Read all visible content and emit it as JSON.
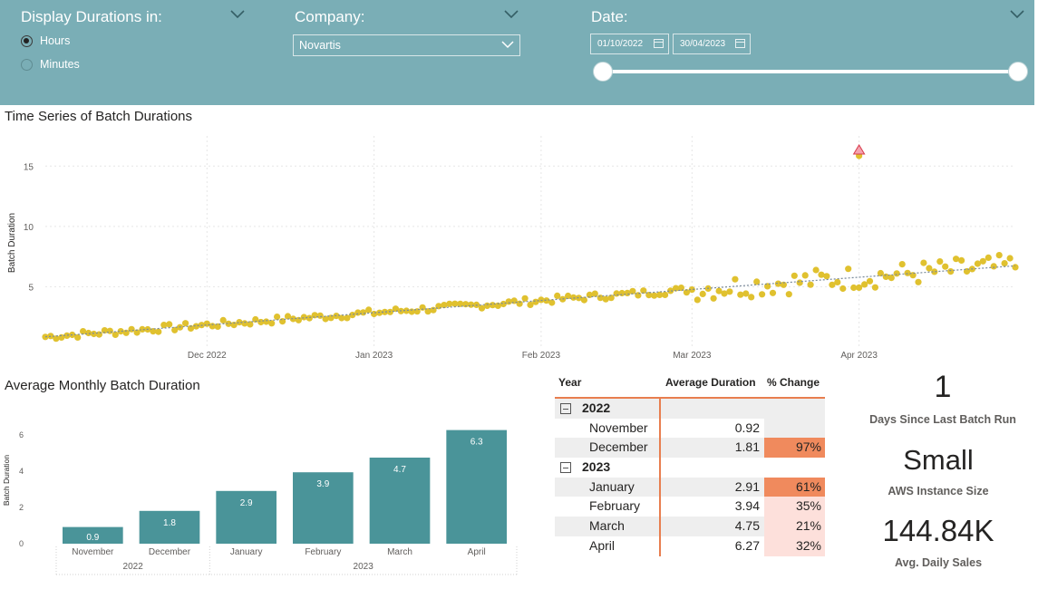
{
  "filters": {
    "duration": {
      "title": "Display Durations in:",
      "options": [
        {
          "label": "Hours",
          "selected": true
        },
        {
          "label": "Minutes",
          "selected": false
        }
      ]
    },
    "company": {
      "title": "Company:",
      "selected": "Novartis"
    },
    "date": {
      "title": "Date:",
      "start": "01/10/2022",
      "end": "30/04/2023",
      "range_fraction": [
        0,
        1
      ]
    }
  },
  "time_series": {
    "title": "Time Series of Batch Durations",
    "chart_data": {
      "type": "scatter",
      "ylabel": "Batch Duration",
      "y_ticks": [
        5,
        10,
        15
      ],
      "ylim": [
        0,
        17.5
      ],
      "x_ticks": [
        "Dec 2022",
        "Jan 2023",
        "Feb 2023",
        "Mar 2023",
        "Apr 2023"
      ],
      "x_start": "2022-11-01",
      "x_end": "2023-04-30",
      "trendline": true,
      "outlier_marker": {
        "date": "2023-04-01",
        "value": 16.3
      },
      "point_color": "#e0c12f"
    }
  },
  "monthly": {
    "title": "Average Monthly Batch Duration",
    "chart_data": {
      "type": "bar",
      "categories": [
        "November",
        "December",
        "January",
        "February",
        "March",
        "April"
      ],
      "years": [
        {
          "label": "2022",
          "span": 2
        },
        {
          "label": "2023",
          "span": 4
        }
      ],
      "values": [
        0.92,
        1.81,
        2.91,
        3.94,
        4.75,
        6.27
      ],
      "data_labels": [
        "0.9",
        "1.8",
        "2.9",
        "3.9",
        "4.7",
        "6.3"
      ],
      "ylabel": "Batch Duration",
      "y_ticks": [
        "0",
        "2",
        "4",
        "6"
      ],
      "ylim": [
        0,
        7
      ],
      "bar_color": "#4a9499"
    }
  },
  "table": {
    "headers": {
      "year": "Year",
      "avg": "Average Duration",
      "pct": "% Change"
    },
    "groups": [
      {
        "year": "2022",
        "rows": [
          {
            "month": "November",
            "avg": "0.92",
            "pct": ""
          },
          {
            "month": "December",
            "avg": "1.81",
            "pct": "97%"
          }
        ]
      },
      {
        "year": "2023",
        "rows": [
          {
            "month": "January",
            "avg": "2.91",
            "pct": "61%"
          },
          {
            "month": "February",
            "avg": "3.94",
            "pct": "35%"
          },
          {
            "month": "March",
            "avg": "4.75",
            "pct": "21%"
          },
          {
            "month": "April",
            "avg": "6.27",
            "pct": "32%"
          }
        ]
      }
    ]
  },
  "kpis": [
    {
      "value": "1",
      "label": "Days Since Last Batch Run"
    },
    {
      "value": "Small",
      "label": "AWS Instance Size"
    },
    {
      "value": "144.84K",
      "label": "Avg. Daily Sales"
    }
  ],
  "colors": {
    "band": "#7aaeb6",
    "accent": "#e87e4f",
    "pct_high": "#f08a5d",
    "pct_low": "#fde0db"
  }
}
